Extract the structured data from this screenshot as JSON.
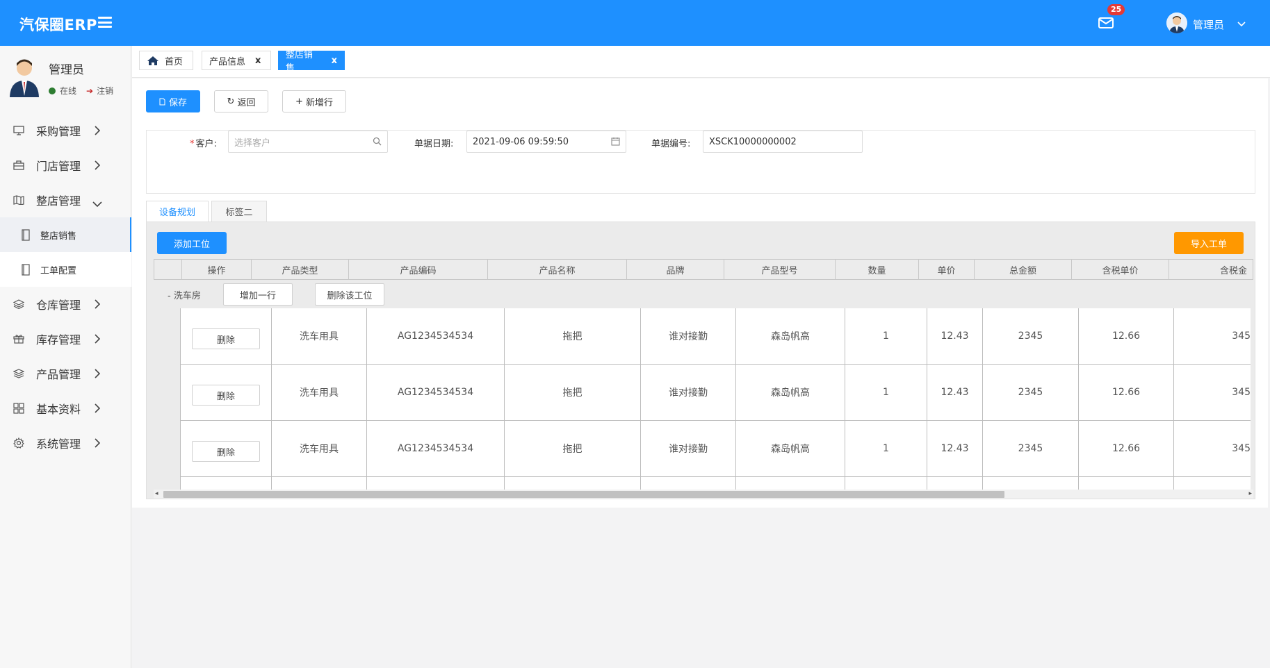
{
  "colors": {
    "primary": "#1e90ff",
    "accent_orange": "#ff9800",
    "badge_red": "#e53935",
    "online_green": "#2e7d32"
  },
  "topbar": {
    "brand": "汽保圈ERP",
    "mail_badge": "25",
    "user": "管理员"
  },
  "profile": {
    "name": "管理员",
    "online": "在线",
    "logout": "注销"
  },
  "menu": {
    "purchase": "采购管理",
    "store": "门店管理",
    "whole_store": "整店管理",
    "sub_sales": "整店销售",
    "sub_config": "工单配置",
    "warehouse": "仓库管理",
    "inventory": "库存管理",
    "product": "产品管理",
    "basic": "基本资料",
    "system": "系统管理"
  },
  "tabs": {
    "home": "首页",
    "product_info": "产品信息",
    "whole_sales": "整店销售",
    "close": "x"
  },
  "toolbar": {
    "save": "保存",
    "back": "返回",
    "add_row": "新增行"
  },
  "form": {
    "customer_label": "客户:",
    "customer_placeholder": "选择客户",
    "date_label": "单据日期:",
    "date_value": "2021-09-06 09:59:50",
    "code_label": "单据编号:",
    "code_value": "XSCK10000000002"
  },
  "panel_tabs": {
    "tab1": "设备规划",
    "tab2": "标签二"
  },
  "grid": {
    "add_station": "添加工位",
    "import_order": "导入工单",
    "headers": [
      "操作",
      "产品类型",
      "产品编码",
      "产品名称",
      "品牌",
      "产品型号",
      "数量",
      "单价",
      "总金额",
      "含税单价",
      "含税金"
    ],
    "group": {
      "label": "- 洗车房",
      "add_row": "增加一行",
      "delete_station": "删除该工位"
    },
    "rows": [
      {
        "op": "删除",
        "type": "洗车用具",
        "code": "AG1234534534",
        "name": "拖把",
        "brand": "谁对接勤",
        "model": "森岛帆高",
        "qty": "1",
        "price": "12.43",
        "total": "2345",
        "tax_price": "12.66",
        "tax_total": "345"
      },
      {
        "op": "删除",
        "type": "洗车用具",
        "code": "AG1234534534",
        "name": "拖把",
        "brand": "谁对接勤",
        "model": "森岛帆高",
        "qty": "1",
        "price": "12.43",
        "total": "2345",
        "tax_price": "12.66",
        "tax_total": "345"
      },
      {
        "op": "删除",
        "type": "洗车用具",
        "code": "AG1234534534",
        "name": "拖把",
        "brand": "谁对接勤",
        "model": "森岛帆高",
        "qty": "1",
        "price": "12.43",
        "total": "2345",
        "tax_price": "12.66",
        "tax_total": "345"
      }
    ]
  }
}
